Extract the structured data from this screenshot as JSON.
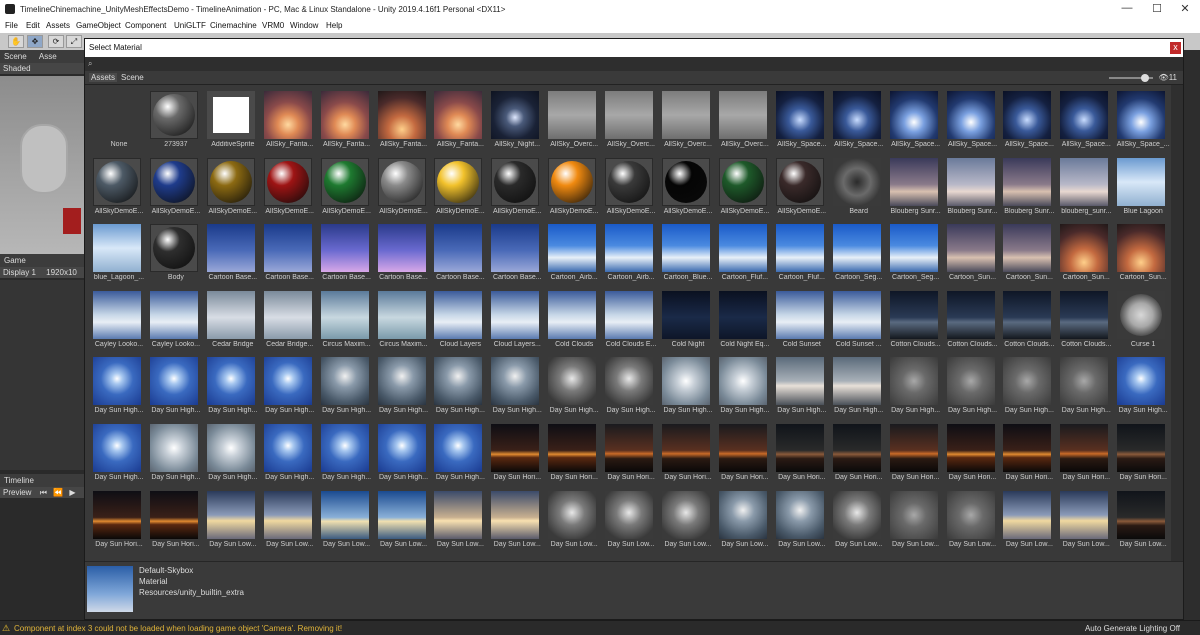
{
  "window": {
    "title": "TimelineChinemachine_UnityMeshEffectsDemo - TimelineAnimation - PC, Mac & Linux Standalone - Unity 2019.4.16f1 Personal <DX11>",
    "minimize": "—",
    "maximize": "☐",
    "close": "✕"
  },
  "menu": [
    "File",
    "Edit",
    "Assets",
    "GameObject",
    "Component",
    "UniGLTF",
    "Cinemachine",
    "VRM0",
    "Window",
    "Help"
  ],
  "toolbar": {
    "tools": [
      "✋",
      "✥",
      "⟳",
      "⤢"
    ]
  },
  "left_panel": {
    "scene_tab": "Scene",
    "assets_tab": "Asse",
    "shading": "Shaded",
    "game_tab": "Game",
    "display": "Display 1",
    "resolution": "1920x10",
    "timeline_tab": "Timeline",
    "preview": "Preview"
  },
  "dialog": {
    "title": "Select Material",
    "close": "x",
    "search_icon": "search-icon",
    "tabs": [
      "Assets",
      "Scene"
    ],
    "item_count": "11"
  },
  "materials": [
    {
      "name": "None",
      "kind": "none"
    },
    {
      "name": "273937",
      "kind": "sphere",
      "color": "#6a6a6a"
    },
    {
      "name": "AdditiveSprite",
      "kind": "white"
    },
    {
      "name": "AllSky_Fanta...",
      "kind": "sunset"
    },
    {
      "name": "AllSky_Fanta...",
      "kind": "sunset"
    },
    {
      "name": "AllSky_Fanta...",
      "kind": "sunset2"
    },
    {
      "name": "AllSky_Fanta...",
      "kind": "sunset"
    },
    {
      "name": "AllSky_Night...",
      "kind": "night"
    },
    {
      "name": "AllSky_Overc...",
      "kind": "overcast"
    },
    {
      "name": "AllSky_Overc...",
      "kind": "overcast"
    },
    {
      "name": "AllSky_Overc...",
      "kind": "overcast"
    },
    {
      "name": "AllSky_Overc...",
      "kind": "overcast"
    },
    {
      "name": "AllSky_Space...",
      "kind": "space"
    },
    {
      "name": "AllSky_Space...",
      "kind": "space"
    },
    {
      "name": "AllSky_Space...",
      "kind": "space2"
    },
    {
      "name": "AllSky_Space...",
      "kind": "space2"
    },
    {
      "name": "AllSky_Space...",
      "kind": "space"
    },
    {
      "name": "AllSky_Space...",
      "kind": "space"
    },
    {
      "name": "AllSky_Space_...",
      "kind": "space2"
    },
    {
      "name": "AllSkyDemoE...",
      "kind": "sphere",
      "color": "#4d5a66"
    },
    {
      "name": "AllSkyDemoE...",
      "kind": "sphere",
      "color": "#1f3c8c"
    },
    {
      "name": "AllSkyDemoE...",
      "kind": "sphere",
      "color": "#8c6a12"
    },
    {
      "name": "AllSkyDemoE...",
      "kind": "sphere",
      "color": "#9e1414"
    },
    {
      "name": "AllSkyDemoE...",
      "kind": "sphere",
      "color": "#1e7a30"
    },
    {
      "name": "AllSkyDemoE...",
      "kind": "sphere",
      "color": "#8a8a8a"
    },
    {
      "name": "AllSkyDemoE...",
      "kind": "sphere",
      "color": "#f2c22c"
    },
    {
      "name": "AllSkyDemoE...",
      "kind": "sphere",
      "color": "#2a2a2a"
    },
    {
      "name": "AllSkyDemoE...",
      "kind": "sphere",
      "color": "#f08a10"
    },
    {
      "name": "AllSkyDemoE...",
      "kind": "sphere",
      "color": "#3a3a3a"
    },
    {
      "name": "AllSkyDemoE...",
      "kind": "sphere",
      "color": "#050505"
    },
    {
      "name": "AllSkyDemoE...",
      "kind": "sphere",
      "color": "#1e5a2a"
    },
    {
      "name": "AllSkyDemoE...",
      "kind": "sphere",
      "color": "#3a2a2a"
    },
    {
      "name": "Beard",
      "kind": "beard"
    },
    {
      "name": "Blouberg Sunr...",
      "kind": "dusk"
    },
    {
      "name": "Blouberg Sunr...",
      "kind": "dusk2"
    },
    {
      "name": "Blouberg Sunr...",
      "kind": "dusk"
    },
    {
      "name": "blouberg_sunr...",
      "kind": "dusk2"
    },
    {
      "name": "Blue Lagoon",
      "kind": "lagoon"
    },
    {
      "name": "blue_Lagoon_...",
      "kind": "lagoon"
    },
    {
      "name": "Body",
      "kind": "sphere",
      "color": "#2e2e2e"
    },
    {
      "name": "Cartoon Base...",
      "kind": "cartoon"
    },
    {
      "name": "Cartoon Base...",
      "kind": "cartoon"
    },
    {
      "name": "Cartoon Base...",
      "kind": "cartoon2"
    },
    {
      "name": "Cartoon Base...",
      "kind": "cartoon2"
    },
    {
      "name": "Cartoon Base...",
      "kind": "cartoon"
    },
    {
      "name": "Cartoon Base...",
      "kind": "cartoon"
    },
    {
      "name": "Cartoon_Airb...",
      "kind": "bluesky"
    },
    {
      "name": "Cartoon_Airb...",
      "kind": "bluesky"
    },
    {
      "name": "Cartoon_Blue...",
      "kind": "bluesky"
    },
    {
      "name": "Cartoon_Fluf...",
      "kind": "bluesky"
    },
    {
      "name": "Cartoon_Fluf...",
      "kind": "bluesky"
    },
    {
      "name": "Cartoon_Seg...",
      "kind": "bluesky"
    },
    {
      "name": "Cartoon_Seg...",
      "kind": "bluesky"
    },
    {
      "name": "Cartoon_Sun...",
      "kind": "dusk"
    },
    {
      "name": "Cartoon_Sun...",
      "kind": "dusk"
    },
    {
      "name": "Cartoon_Sun...",
      "kind": "sunset2"
    },
    {
      "name": "Cartoon_Sun...",
      "kind": "sunset2"
    },
    {
      "name": "Cayley Looko...",
      "kind": "clouds"
    },
    {
      "name": "Cayley Looko...",
      "kind": "clouds"
    },
    {
      "name": "Cedar Bridge",
      "kind": "grey"
    },
    {
      "name": "Cedar Bridge...",
      "kind": "grey"
    },
    {
      "name": "Circus Maxim...",
      "kind": "greyblue"
    },
    {
      "name": "Circus Maxim...",
      "kind": "greyblue"
    },
    {
      "name": "Cloud Layers",
      "kind": "clouds"
    },
    {
      "name": "Cloud Layers...",
      "kind": "clouds"
    },
    {
      "name": "Cold Clouds",
      "kind": "clouds"
    },
    {
      "name": "Cold Clouds E...",
      "kind": "clouds"
    },
    {
      "name": "Cold Night",
      "kind": "coldnight"
    },
    {
      "name": "Cold Night Eq...",
      "kind": "coldnight"
    },
    {
      "name": "Cold Sunset",
      "kind": "clouds"
    },
    {
      "name": "Cold Sunset ...",
      "kind": "clouds"
    },
    {
      "name": "Cotton Clouds...",
      "kind": "cotton"
    },
    {
      "name": "Cotton Clouds...",
      "kind": "cotton"
    },
    {
      "name": "Cotton Clouds...",
      "kind": "cotton"
    },
    {
      "name": "Cotton Clouds...",
      "kind": "cotton"
    },
    {
      "name": "Curse 1",
      "kind": "curse"
    },
    {
      "name": "Day Sun High...",
      "kind": "daysun"
    },
    {
      "name": "Day Sun High...",
      "kind": "daysun"
    },
    {
      "name": "Day Sun High...",
      "kind": "daysun"
    },
    {
      "name": "Day Sun High...",
      "kind": "daysun"
    },
    {
      "name": "Day Sun High...",
      "kind": "stormy"
    },
    {
      "name": "Day Sun High...",
      "kind": "stormy"
    },
    {
      "name": "Day Sun High...",
      "kind": "stormy"
    },
    {
      "name": "Day Sun High...",
      "kind": "stormy"
    },
    {
      "name": "Day Sun High...",
      "kind": "stormy2"
    },
    {
      "name": "Day Sun High...",
      "kind": "stormy2"
    },
    {
      "name": "Day Sun High...",
      "kind": "haze"
    },
    {
      "name": "Day Sun High...",
      "kind": "haze"
    },
    {
      "name": "Day Sun High...",
      "kind": "haze2"
    },
    {
      "name": "Day Sun High...",
      "kind": "haze2"
    },
    {
      "name": "Day Sun High...",
      "kind": "fog"
    },
    {
      "name": "Day Sun High...",
      "kind": "fog"
    },
    {
      "name": "Day Sun High...",
      "kind": "fog"
    },
    {
      "name": "Day Sun High...",
      "kind": "fog"
    },
    {
      "name": "Day Sun High...",
      "kind": "daysun"
    },
    {
      "name": "Day Sun High...",
      "kind": "daysun"
    },
    {
      "name": "Day Sun High...",
      "kind": "haze"
    },
    {
      "name": "Day Sun High...",
      "kind": "haze"
    },
    {
      "name": "Day Sun High...",
      "kind": "daysun"
    },
    {
      "name": "Day Sun High...",
      "kind": "daysun"
    },
    {
      "name": "Day Sun High...",
      "kind": "daysun"
    },
    {
      "name": "Day Sun High...",
      "kind": "daysun"
    },
    {
      "name": "Day Sun Hori...",
      "kind": "horizon"
    },
    {
      "name": "Day Sun Hori...",
      "kind": "horizon"
    },
    {
      "name": "Day Sun Hori...",
      "kind": "horizon2"
    },
    {
      "name": "Day Sun Hori...",
      "kind": "horizon2"
    },
    {
      "name": "Day Sun Hori...",
      "kind": "horizon2"
    },
    {
      "name": "Day Sun Hori...",
      "kind": "horizon3"
    },
    {
      "name": "Day Sun Hori...",
      "kind": "horizon3"
    },
    {
      "name": "Day Sun Hori...",
      "kind": "horizon2"
    },
    {
      "name": "Day Sun Hori...",
      "kind": "horizon"
    },
    {
      "name": "Day Sun Hori...",
      "kind": "horizon"
    },
    {
      "name": "Day Sun Hori...",
      "kind": "horizon2"
    },
    {
      "name": "Day Sun Hori...",
      "kind": "horizon3"
    },
    {
      "name": "Day Sun Hori...",
      "kind": "horizon"
    },
    {
      "name": "Day Sun Hori...",
      "kind": "horizon"
    },
    {
      "name": "Day Sun Low...",
      "kind": "low"
    },
    {
      "name": "Day Sun Low...",
      "kind": "low"
    },
    {
      "name": "Day Sun Low...",
      "kind": "low2"
    },
    {
      "name": "Day Sun Low...",
      "kind": "low2"
    },
    {
      "name": "Day Sun Low...",
      "kind": "low3"
    },
    {
      "name": "Day Sun Low...",
      "kind": "low3"
    },
    {
      "name": "Day Sun Low...",
      "kind": "stormy2"
    },
    {
      "name": "Day Sun Low...",
      "kind": "stormy2"
    },
    {
      "name": "Day Sun Low...",
      "kind": "stormy2"
    },
    {
      "name": "Day Sun Low...",
      "kind": "stormy"
    },
    {
      "name": "Day Sun Low...",
      "kind": "stormy"
    },
    {
      "name": "Day Sun Low...",
      "kind": "stormy2"
    },
    {
      "name": "Day Sun Low...",
      "kind": "fog"
    },
    {
      "name": "Day Sun Low...",
      "kind": "fog"
    },
    {
      "name": "Day Sun Low...",
      "kind": "low"
    },
    {
      "name": "Day Sun Low...",
      "kind": "low"
    },
    {
      "name": "Day Sun Low...",
      "kind": "horizon3"
    }
  ],
  "preview": {
    "name": "Default-Skybox",
    "type": "Material",
    "path": "Resources/unity_builtin_extra"
  },
  "status": {
    "warning_icon": "warning-icon",
    "message": "Component at index 3 could not be loaded when loading game object 'Camera'. Removing it!",
    "right": "Auto Generate Lighting Off"
  }
}
